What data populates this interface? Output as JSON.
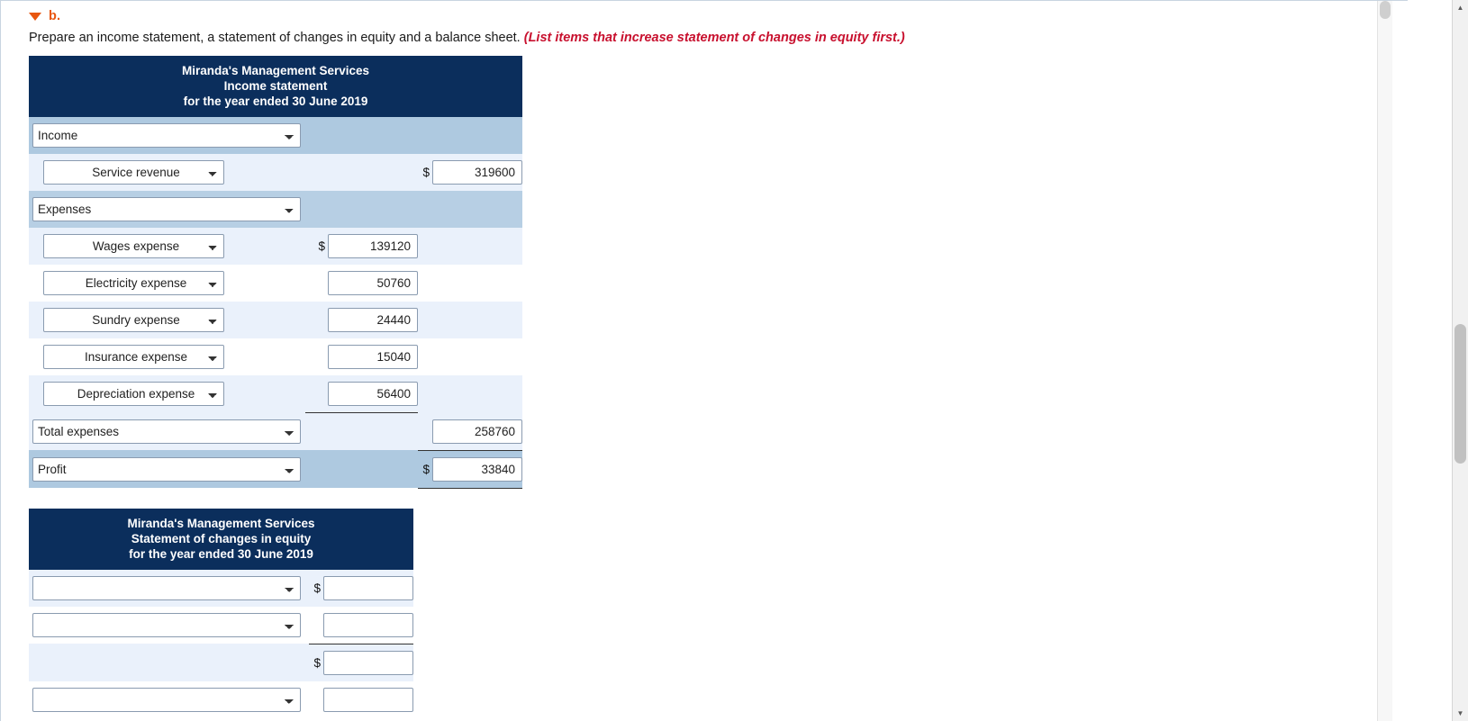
{
  "question": {
    "part_label": "b.",
    "instruction_text": "Prepare an income statement, a statement of changes in equity and a balance sheet. ",
    "instruction_hint": "(List items that increase statement of changes in equity first.)"
  },
  "colors": {
    "accent_orange": "#e8560f",
    "hint_red": "#c8102e",
    "banner_navy": "#0b2e5c",
    "row_light": "#eaf1fb",
    "row_mid": "#aec9e0"
  },
  "income_statement": {
    "banner": {
      "line1": "Miranda's Management Services",
      "line2": "Income statement",
      "line3": "for the year ended 30 June 2019"
    },
    "rows": [
      {
        "label": "Income",
        "dollar": "$",
        "amount": ""
      },
      {
        "label": "Service revenue",
        "dollar": "$",
        "amount": "319600"
      },
      {
        "label": "Expenses",
        "dollar": "",
        "amount": ""
      },
      {
        "label": "Wages expense",
        "dollar": "$",
        "amount": "139120"
      },
      {
        "label": "Electricity expense",
        "dollar": "",
        "amount": "50760"
      },
      {
        "label": "Sundry expense",
        "dollar": "",
        "amount": "24440"
      },
      {
        "label": "Insurance expense",
        "dollar": "",
        "amount": "15040"
      },
      {
        "label": "Depreciation expense",
        "dollar": "",
        "amount": "56400"
      },
      {
        "label": "Total expenses",
        "dollar": "",
        "amount": "258760"
      },
      {
        "label": "Profit",
        "dollar": "$",
        "amount": "33840"
      }
    ]
  },
  "equity_statement": {
    "banner": {
      "line1": "Miranda's Management Services",
      "line2": "Statement of changes in equity",
      "line3": "for the year ended 30 June 2019"
    },
    "rows": [
      {
        "label": "",
        "dollar": "$",
        "amount": ""
      },
      {
        "label": "",
        "dollar": "",
        "amount": ""
      },
      {
        "label": "",
        "dollar": "$",
        "amount": ""
      },
      {
        "label": "",
        "dollar": "",
        "amount": ""
      }
    ]
  },
  "scrollbars": {
    "up_arrow": "▲",
    "down_arrow": "▼"
  }
}
